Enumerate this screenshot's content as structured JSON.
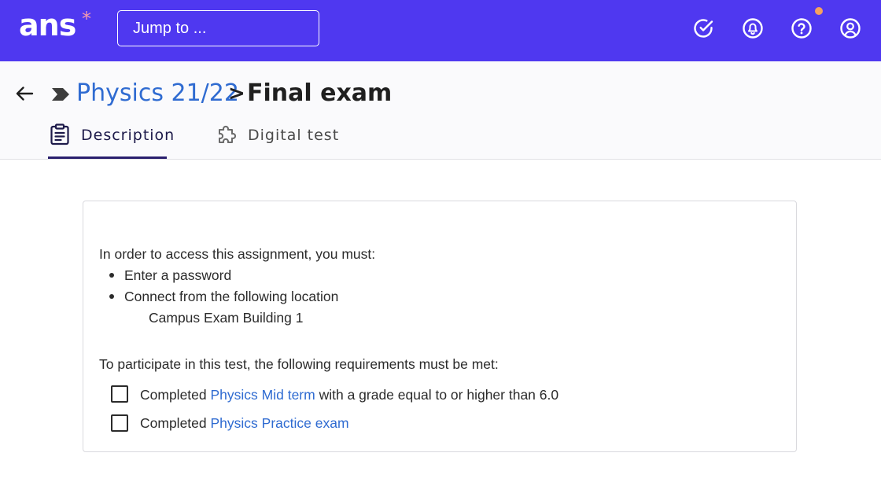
{
  "topbar": {
    "logo_text": "ans",
    "logo_mark": "*",
    "search_placeholder": "Jump to ...",
    "icons": [
      "check-circle-icon",
      "bell-icon",
      "help-icon",
      "user-icon"
    ],
    "accent_color": "#4f38f0",
    "notification_color": "#f5a15f"
  },
  "breadcrumb": {
    "parent": "Physics 21/22",
    "separator": ">",
    "current": "Final exam"
  },
  "tabs": [
    {
      "label": "Description",
      "icon": "clipboard-icon",
      "active": true
    },
    {
      "label": "Digital test",
      "icon": "puzzle-icon",
      "active": false
    }
  ],
  "access": {
    "intro": "In order to access this assignment, you must:",
    "items": [
      "Enter a password",
      "Connect from the following location"
    ],
    "location": "Campus Exam Building 1"
  },
  "requirements": {
    "intro": "To participate in this test, the following requirements must be met:",
    "items": [
      {
        "prefix": "Completed ",
        "link": "Physics Mid term",
        "suffix": " with a grade equal to or higher than 6.0",
        "checked": false
      },
      {
        "prefix": "Completed ",
        "link": "Physics Practice exam",
        "suffix": "",
        "checked": false
      }
    ]
  }
}
